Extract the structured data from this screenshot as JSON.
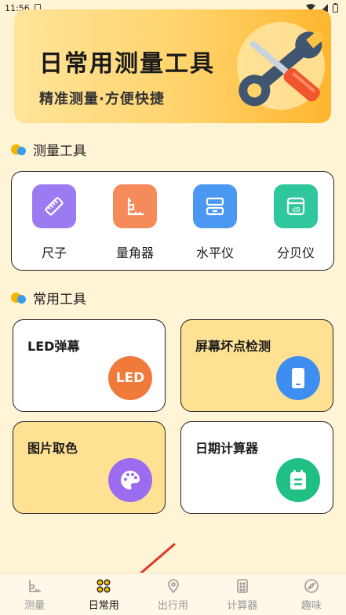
{
  "status": {
    "time": "11:56"
  },
  "banner": {
    "title": "日常用测量工具",
    "subtitle": "精准测量·方便快捷"
  },
  "sections": {
    "measure_title": "测量工具",
    "common_title": "常用工具"
  },
  "measure_tools": [
    {
      "label": "尺子",
      "icon": "ruler-icon",
      "color": "#9C7BF2"
    },
    {
      "label": "量角器",
      "icon": "protractor-icon",
      "color": "#F58A5B"
    },
    {
      "label": "水平仪",
      "icon": "level-icon",
      "color": "#4A98F2"
    },
    {
      "label": "分贝仪",
      "icon": "decibel-icon",
      "color": "#2FC79B"
    }
  ],
  "common_tools": [
    {
      "label": "LED弹幕",
      "icon_text": "LED",
      "icon": "led-icon",
      "color": "#F07A3A",
      "bg": "white"
    },
    {
      "label": "屏幕坏点检测",
      "icon": "phone-icon",
      "color": "#3E8EF0",
      "bg": "yellow"
    },
    {
      "label": "图片取色",
      "icon": "palette-icon",
      "color": "#9B6CF0",
      "bg": "yellow"
    },
    {
      "label": "日期计算器",
      "icon": "calendar-icon",
      "color": "#1FBF86",
      "bg": "white"
    }
  ],
  "tabbar": {
    "items": [
      {
        "label": "测量",
        "icon": "ruler-tab-icon",
        "active": false
      },
      {
        "label": "日常用",
        "icon": "grid-tab-icon",
        "active": true
      },
      {
        "label": "出行用",
        "icon": "location-tab-icon",
        "active": false
      },
      {
        "label": "计算器",
        "icon": "calculator-tab-icon",
        "active": false
      },
      {
        "label": "趣味",
        "icon": "rocket-tab-icon",
        "active": false
      }
    ]
  }
}
